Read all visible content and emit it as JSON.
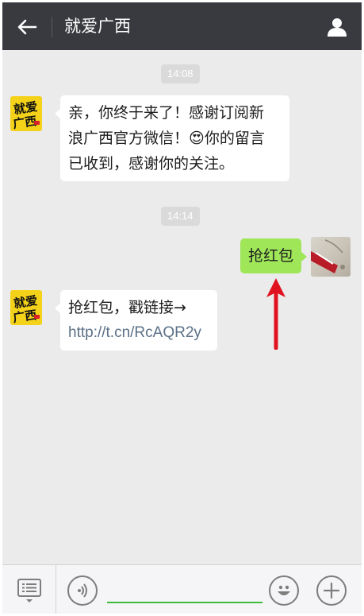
{
  "header": {
    "title": "就爱广西"
  },
  "messages": {
    "time1": "14:08",
    "welcome_line1": "亲，你终于来了！感谢订阅新",
    "welcome_line2_a": "浪广西官方微信！",
    "welcome_emoji": "😍",
    "welcome_line2_b": "你的留言",
    "welcome_line3": "已收到，感谢你的关注。",
    "time2": "14:14",
    "sent_text": "抢红包",
    "reply_line1": "抢红包，戳链接→",
    "reply_link": "http://t.cn/RcAQR2y"
  },
  "brand_avatar": {
    "text_top": "就爱",
    "text_bottom": "广西"
  },
  "input": {
    "value": "",
    "placeholder": ""
  },
  "colors": {
    "header_bg": "#393a3f",
    "chat_bg": "#ebebeb",
    "sent_bubble": "#9fe658",
    "received_bubble": "#ffffff",
    "link": "#5b7087",
    "input_underline": "#3fbc3a",
    "annotation_arrow": "#e0121f"
  },
  "icons": {
    "back": "back-arrow-icon",
    "profile": "person-icon",
    "menu": "list-menu-icon",
    "voice": "voice-icon",
    "emoji": "smiley-icon",
    "more": "plus-icon"
  }
}
